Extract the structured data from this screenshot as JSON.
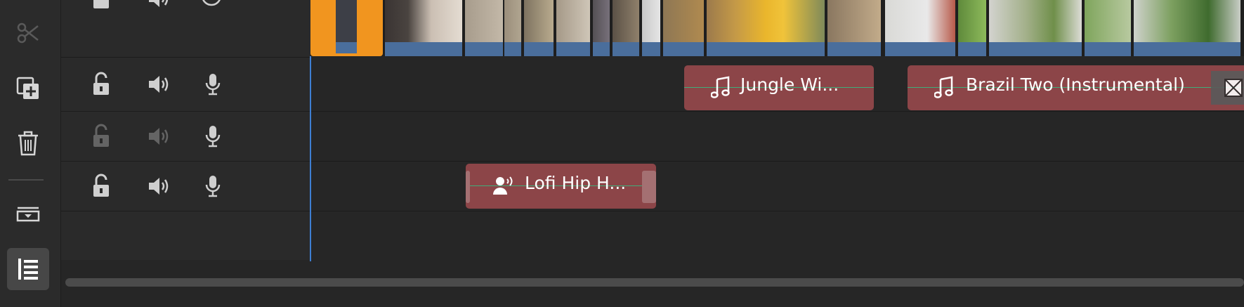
{
  "toolbar": {
    "tools": [
      {
        "name": "split",
        "icon": "scissors-icon",
        "enabled": false
      },
      {
        "name": "duplicate",
        "icon": "duplicate-icon",
        "enabled": true
      },
      {
        "name": "delete",
        "icon": "trash-icon",
        "enabled": true
      },
      {
        "name": "collapse-tracks",
        "icon": "track-toggle-icon",
        "enabled": true
      },
      {
        "name": "track-list",
        "icon": "list-icon",
        "enabled": true,
        "selected": true
      }
    ]
  },
  "tracks": [
    {
      "id": "video",
      "controls": [
        "lock-icon",
        "speaker-icon",
        "eye-icon"
      ],
      "dimmed": false
    },
    {
      "id": "audio-1",
      "controls": [
        "unlock-icon",
        "speaker-icon",
        "microphone-icon"
      ],
      "dimmed": false
    },
    {
      "id": "audio-2",
      "controls": [
        "unlock-icon",
        "speaker-icon",
        "microphone-icon"
      ],
      "dimmed": true
    },
    {
      "id": "audio-3",
      "controls": [
        "unlock-icon",
        "speaker-icon",
        "microphone-icon"
      ],
      "dimmed": false
    }
  ],
  "audio_clips": {
    "jungle": {
      "title": "Jungle Wi...",
      "icon": "music-note-icon",
      "track": "audio-1"
    },
    "brazil": {
      "title": "Brazil Two (Instrumental)",
      "icon": "music-note-icon",
      "track": "audio-1"
    },
    "lofi": {
      "title": "Lofi Hip H...",
      "icon": "voiceover-icon",
      "track": "audio-3"
    }
  },
  "colors": {
    "accent_selected": "#f1951f",
    "audio_clip": "#8c4548",
    "audio_level_line": "#3fae7a",
    "video_waveform": "#4a6e9c",
    "playhead": "#3e7ed2"
  }
}
